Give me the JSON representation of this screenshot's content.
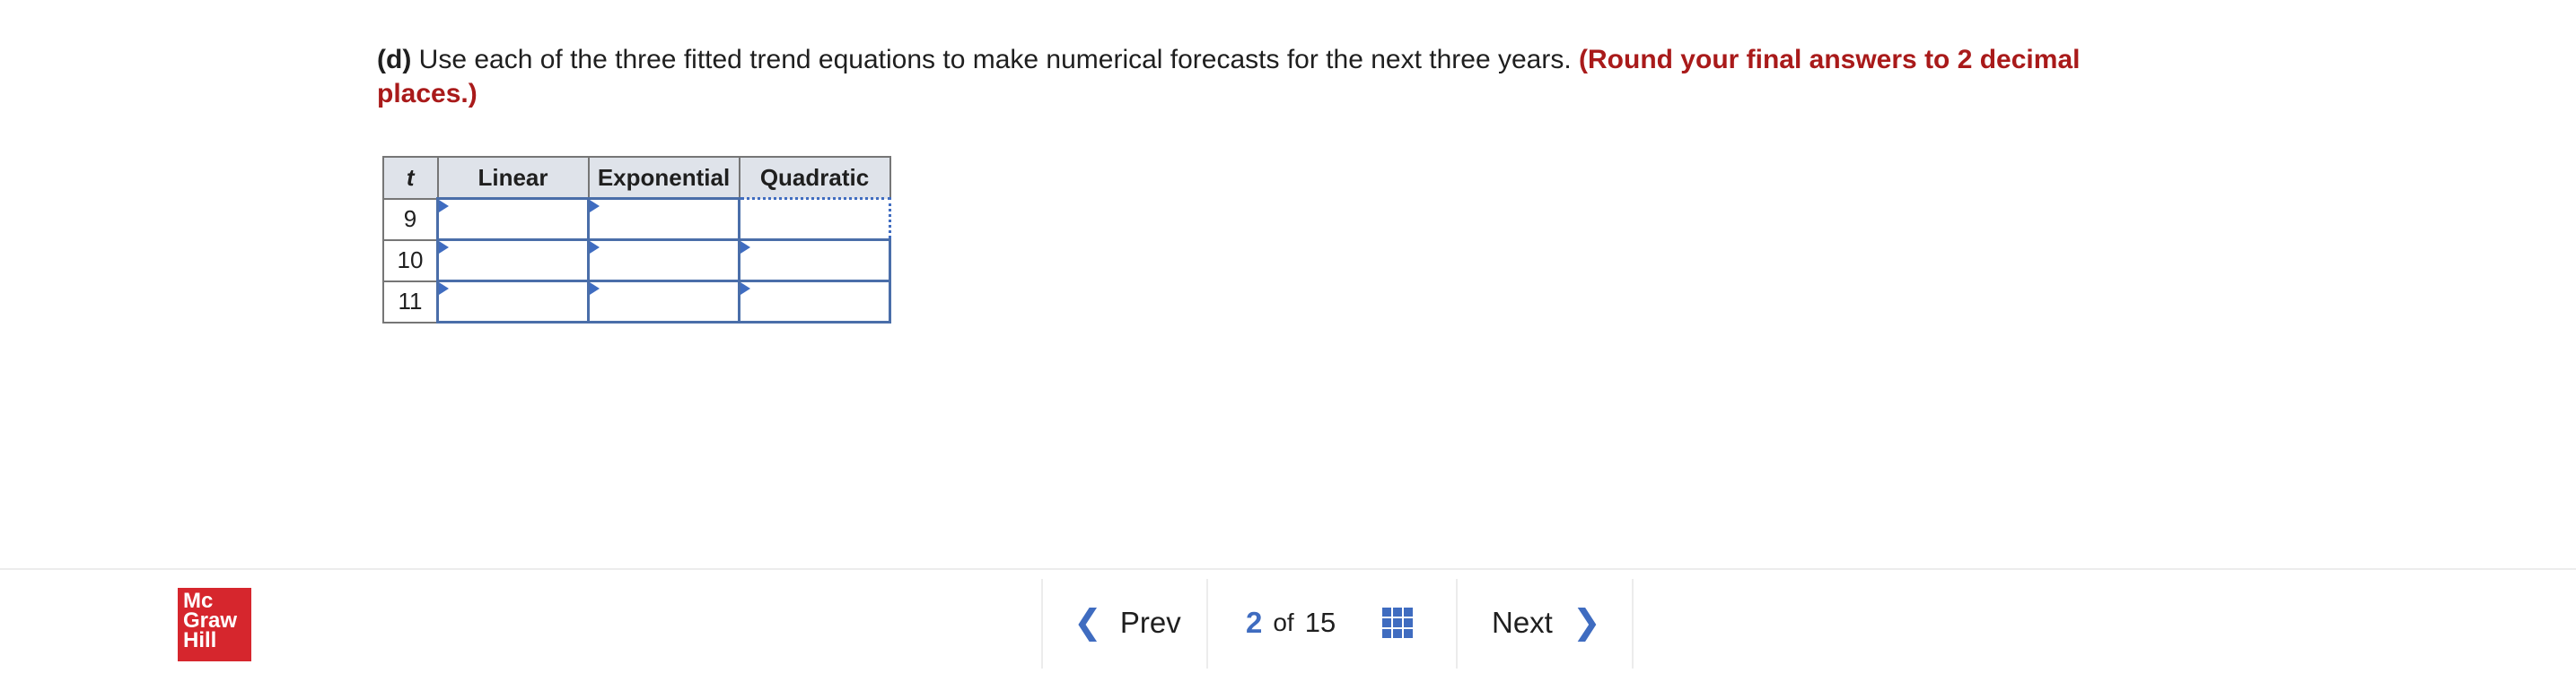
{
  "question": {
    "part": "(d)",
    "text": " Use each of the three fitted trend equations to make numerical forecasts for the next three years. ",
    "hint": "(Round your final answers to 2 decimal places.)"
  },
  "table": {
    "headers": [
      "t",
      "Linear",
      "Exponential",
      "Quadratic"
    ],
    "rows": [
      {
        "t": "9",
        "linear": "",
        "exponential": "",
        "quadratic": ""
      },
      {
        "t": "10",
        "linear": "",
        "exponential": "",
        "quadratic": ""
      },
      {
        "t": "11",
        "linear": "",
        "exponential": "",
        "quadratic": ""
      }
    ]
  },
  "footer": {
    "logo": [
      "Mc",
      "Graw",
      "Hill"
    ],
    "prev_label": "Prev",
    "next_label": "Next",
    "current_page": "2",
    "of_label": "of",
    "total_pages": "15"
  },
  "colors": {
    "accent": "#3f6cc0",
    "hint": "#a91a1a",
    "logo_bg": "#d6262d",
    "header_bg": "#dfe3ea"
  },
  "icons": [
    "chevron-left-icon",
    "grid-icon",
    "chevron-right-icon"
  ]
}
